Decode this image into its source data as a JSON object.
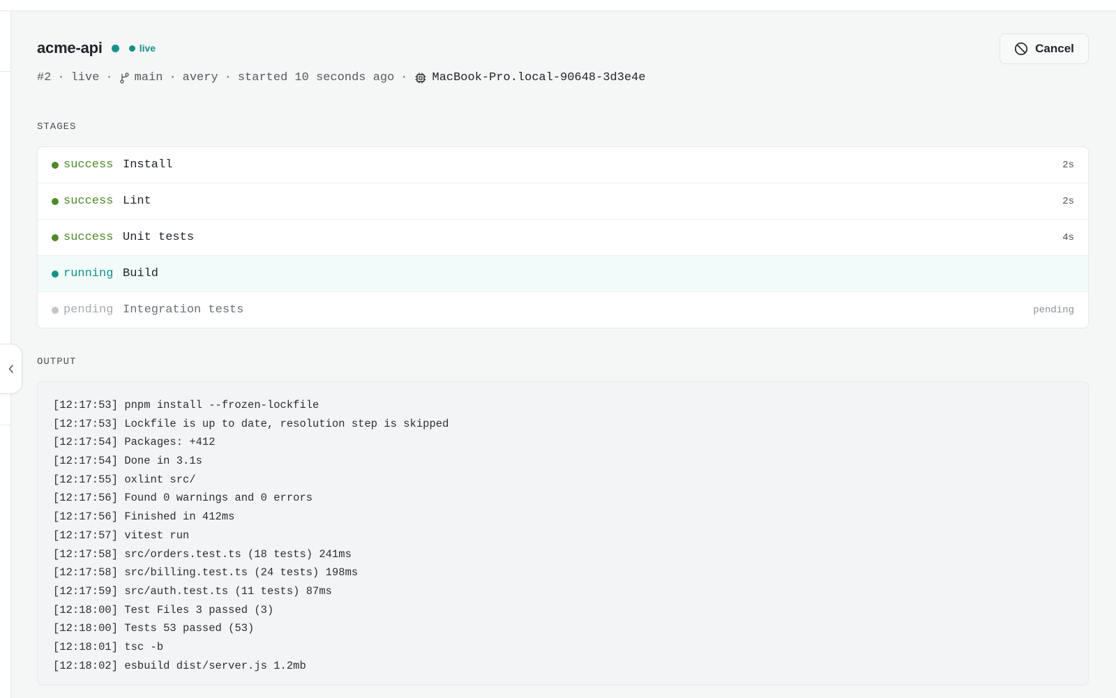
{
  "pipeline": {
    "name": "acme-api",
    "status_badge": "live",
    "meta": {
      "run_number": "#2",
      "state": "live",
      "branch": "main",
      "author": "avery",
      "started": "started 10 seconds ago",
      "host": "MacBook-Pro.local-90648-3d3e4e"
    },
    "cancel_label": "Cancel"
  },
  "stages_label": "STAGES",
  "stages": [
    {
      "status": "success",
      "name": "Install",
      "duration": "2s"
    },
    {
      "status": "success",
      "name": "Lint",
      "duration": "2s"
    },
    {
      "status": "success",
      "name": "Unit tests",
      "duration": "4s"
    },
    {
      "status": "running",
      "name": "Build",
      "duration": ""
    },
    {
      "status": "pending",
      "name": "Integration tests",
      "duration": "pending"
    }
  ],
  "output_label": "OUTPUT",
  "output_lines": [
    "[12:17:53] pnpm install --frozen-lockfile",
    "[12:17:53] Lockfile is up to date, resolution step is skipped",
    "[12:17:54] Packages: +412",
    "[12:17:54] Done in 3.1s",
    "[12:17:55] oxlint src/",
    "[12:17:56] Found 0 warnings and 0 errors",
    "[12:17:56] Finished in 412ms",
    "[12:17:57] vitest run",
    "[12:17:58] src/orders.test.ts (18 tests) 241ms",
    "[12:17:58] src/billing.test.ts (24 tests) 198ms",
    "[12:17:59] src/auth.test.ts (11 tests) 87ms",
    "[12:18:00] Test Files 3 passed (3)",
    "[12:18:00] Tests 53 passed (53)",
    "[12:18:01] tsc -b",
    "[12:18:02] esbuild dist/server.js 1.2mb"
  ],
  "colors": {
    "success": "#4d8a2c",
    "running": "#14918a",
    "pending": "#c3c6c9",
    "live": "#14918a"
  },
  "icons": {
    "cancel": "cancel-circle-slash-icon",
    "branch": "git-branch-icon",
    "host": "chip-icon",
    "collapse": "chevron-left-icon"
  }
}
